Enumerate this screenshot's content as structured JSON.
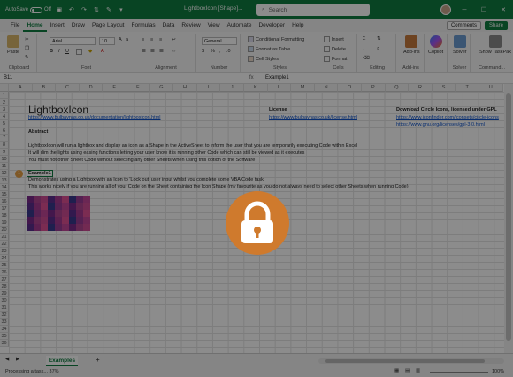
{
  "titlebar": {
    "autosave": "AutoSave",
    "autosave_state": "Off",
    "doc_title": "LightboxIcon [Shape]...",
    "search_placeholder": "Search"
  },
  "menu": {
    "tabs": [
      "File",
      "Home",
      "Insert",
      "Draw",
      "Page Layout",
      "Formulas",
      "Data",
      "Review",
      "View",
      "Automate",
      "Developer",
      "Help"
    ],
    "active": "Home",
    "comments": "Comments",
    "share": "Share"
  },
  "ribbon": {
    "clipboard": {
      "label": "Clipboard",
      "paste": "Paste"
    },
    "font": {
      "label": "Font",
      "name": "Arial",
      "size": "10"
    },
    "alignment": {
      "label": "Alignment"
    },
    "number": {
      "label": "Number",
      "format": "General"
    },
    "styles": {
      "label": "Styles",
      "cond": "Conditional Formatting",
      "table": "Format as Table",
      "cell": "Cell Styles"
    },
    "cells": {
      "label": "Cells",
      "insert": "Insert",
      "delete": "Delete",
      "format": "Format"
    },
    "editing": {
      "label": "Editing"
    },
    "addins": {
      "label": "Add-ins",
      "btn": "Add-ins"
    },
    "copilot": {
      "btn": "Copilot"
    },
    "solver": {
      "label": "Solver",
      "btn": "Solver"
    },
    "command": {
      "label": "Command...",
      "btn": "Show TaskPak"
    }
  },
  "formula": {
    "namebox": "B11",
    "fx": "fx",
    "content": "Example1"
  },
  "columns": [
    "A",
    "B",
    "C",
    "D",
    "E",
    "F",
    "G",
    "H",
    "I",
    "J",
    "K",
    "L",
    "M",
    "N",
    "O",
    "P",
    "Q",
    "R",
    "S",
    "T",
    "U"
  ],
  "rows": [
    "1",
    "2",
    "3",
    "4",
    "5",
    "6",
    "7",
    "8",
    "9",
    "10",
    "11",
    "12",
    "13",
    "14",
    "15",
    "16",
    "17",
    "18",
    "19",
    "20",
    "21",
    "22",
    "23",
    "24",
    "25",
    "26",
    "27",
    "28",
    "29",
    "30",
    "31",
    "32",
    "33",
    "34",
    "35",
    "36"
  ],
  "sheet": {
    "title": "LightboxIcon",
    "doc_link": "https://www.bulbaynas.co.uk/documentation/lightboxicon.html",
    "license_label": "License",
    "license_link": "https://www.bulbaynas.co.uk/license.html",
    "icons_label": "Download Circle Icons, licensed under GPL",
    "icons_link1": "https://www.iconfinder.com/iconsets/circle-icons",
    "icons_link2": "https://www.gnu.org/licenses/gpl-3.0.html",
    "abstract": "Abstract",
    "abs1": "LightboxIcon will run a lightbox and display an icon as a Shape in the ActiveSheet to inform the user that you are temporarily executing Code within Excel",
    "abs2": "It will dim the lights using easing functions letting your user know it is running other Code which can still be viewed as it executes",
    "abs3": "You must not other Sheet Code without selecting any other Sheets when using this option of the Software",
    "example_label": "Example1",
    "ex1": "Demonstrates using a Lightbox with an Icon to 'Lock out' user input whilst you complete some VBA Code task",
    "ex2": "This works nicely if you are running all of your Code on the Sheet containing the Icon Shape (my favourite as you do not always need to select other Sheets when running Code)",
    "badge": "1"
  },
  "heatmap_colors": [
    "#7b2a8a",
    "#a63b93",
    "#c3479a",
    "#5c2e8e",
    "#9a3c95",
    "#d04e96",
    "#3a3a8f",
    "#b14593",
    "#e15096"
  ],
  "sheettabs": {
    "active": "Examples",
    "add": "+"
  },
  "status": {
    "left": "Processing a task... 37%",
    "zoom": "100%"
  },
  "overlay": {
    "icon": "lock-icon"
  }
}
